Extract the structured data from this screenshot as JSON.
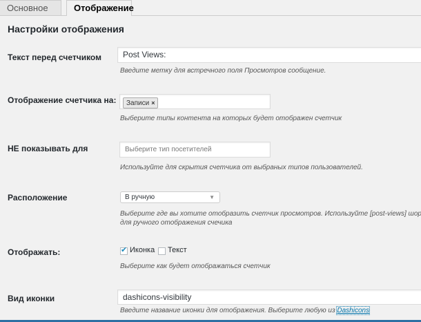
{
  "tabs": [
    {
      "label": "Основное"
    },
    {
      "label": "Отображение"
    }
  ],
  "section_title": "Настройки отображения",
  "fields": {
    "label_text": {
      "label": "Текст перед счетчиком",
      "value": "Post Views:",
      "description": "Введите метку для встречного поля Просмотров сообщение."
    },
    "display_on": {
      "label": "Отображение счетчика на:",
      "token": "Записи",
      "token_remove": "×",
      "description": "Выберите типы контента на которых будет отображен счетчик"
    },
    "exclude": {
      "label": "НЕ показывать для",
      "placeholder": "Выберите тип посетителей",
      "description": "Используйте для скрытия счетчика от выбраных типов пользователей."
    },
    "position": {
      "label": "Расположение",
      "selected": "В ручную",
      "arrow": "▼",
      "description_line1": "Выберите где вы хотите отобразить счетчик просмотров. Используйте [post-views] шорткод",
      "description_line2": "для ручного отображения счечика"
    },
    "display_style": {
      "label": "Отображать:",
      "options": [
        {
          "label": "Иконка",
          "checked": true
        },
        {
          "label": "Текст",
          "checked": false
        }
      ],
      "checkmark": "✔",
      "description": "Выберите как будет отображаться счетчик"
    },
    "icon": {
      "label": "Вид иконки",
      "value": "dashicons-visibility",
      "description_prefix": "Введите название иконки для отображения. Выберите любую из ",
      "description_link": "Dashicons"
    }
  }
}
